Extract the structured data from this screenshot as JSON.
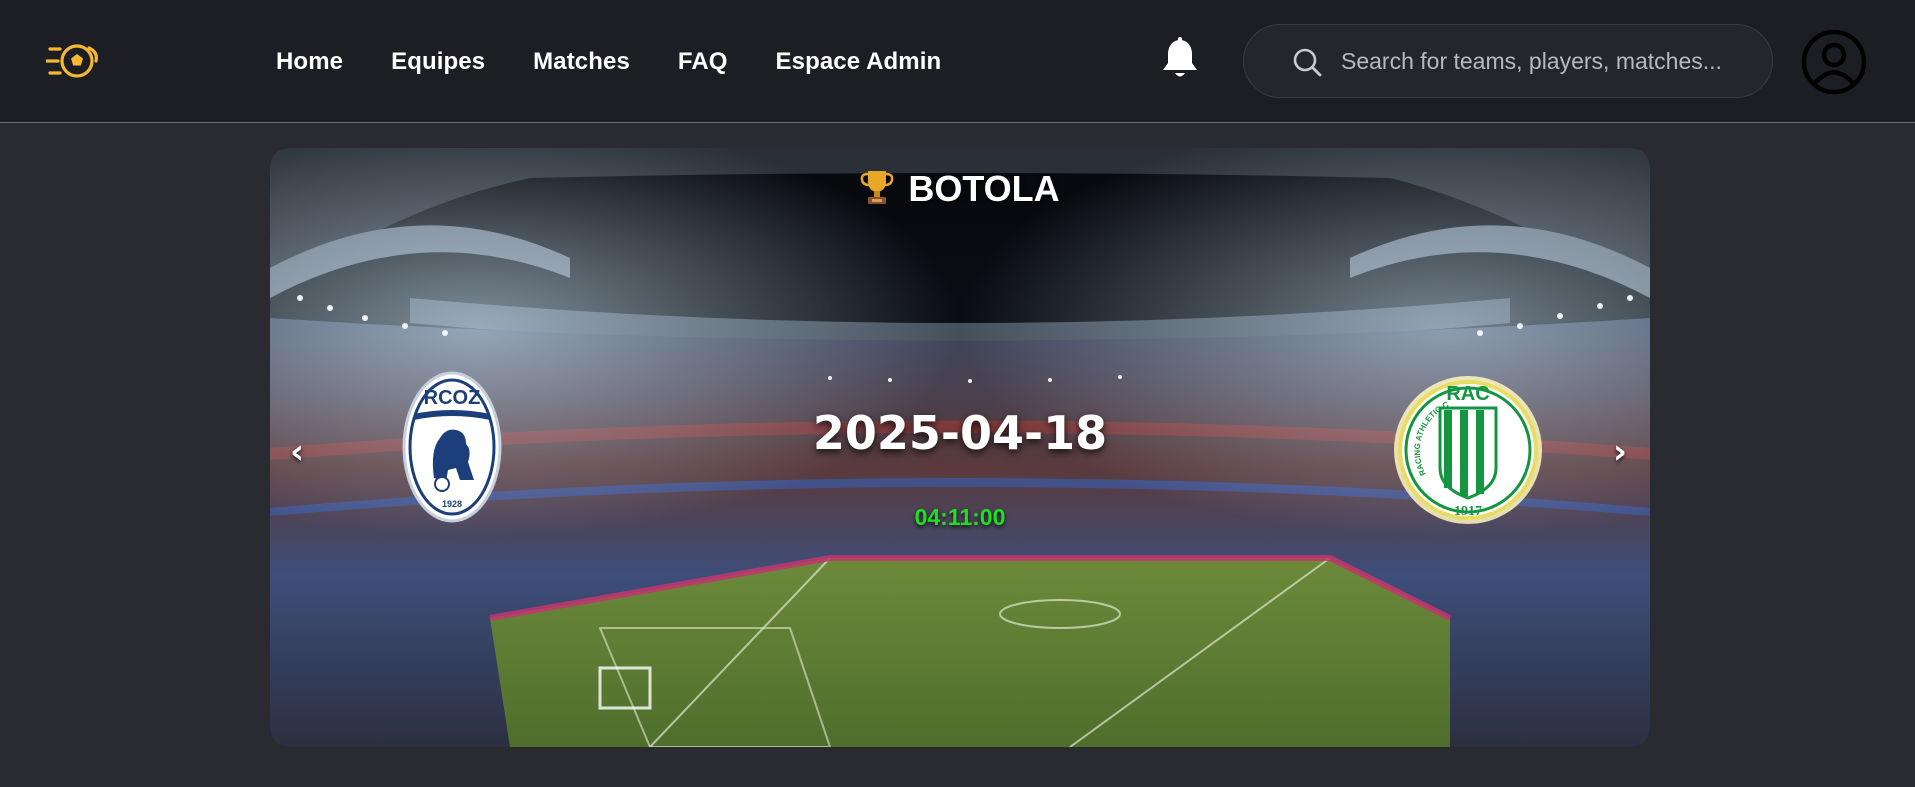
{
  "nav": {
    "links": [
      "Home",
      "Equipes",
      "Matches",
      "FAQ",
      "Espace Admin"
    ]
  },
  "search": {
    "placeholder": "Search for teams, players, matches..."
  },
  "icons": {
    "logo": "football-speed-logo",
    "notifications": "bell-icon",
    "search": "search-icon",
    "account": "user-circle-icon",
    "league": "trophy-icon"
  },
  "colors": {
    "accent": "#f5b833",
    "time": "#1fe01f",
    "navbar_bg": "#1d1e23",
    "page_bg": "#2a2b30",
    "home_team": "#1c3f7c",
    "away_team": "#149640"
  },
  "hero": {
    "league": "BOTOLA",
    "date": "2025-04-18",
    "time": "04:11:00",
    "prev": "‹",
    "next": "›",
    "home_team": {
      "short_name": "RCOZ",
      "founded": "1928"
    },
    "away_team": {
      "short_name": "RAC",
      "arc_text": "RACING ATHLETIC CLUB",
      "founded": "1917"
    }
  }
}
